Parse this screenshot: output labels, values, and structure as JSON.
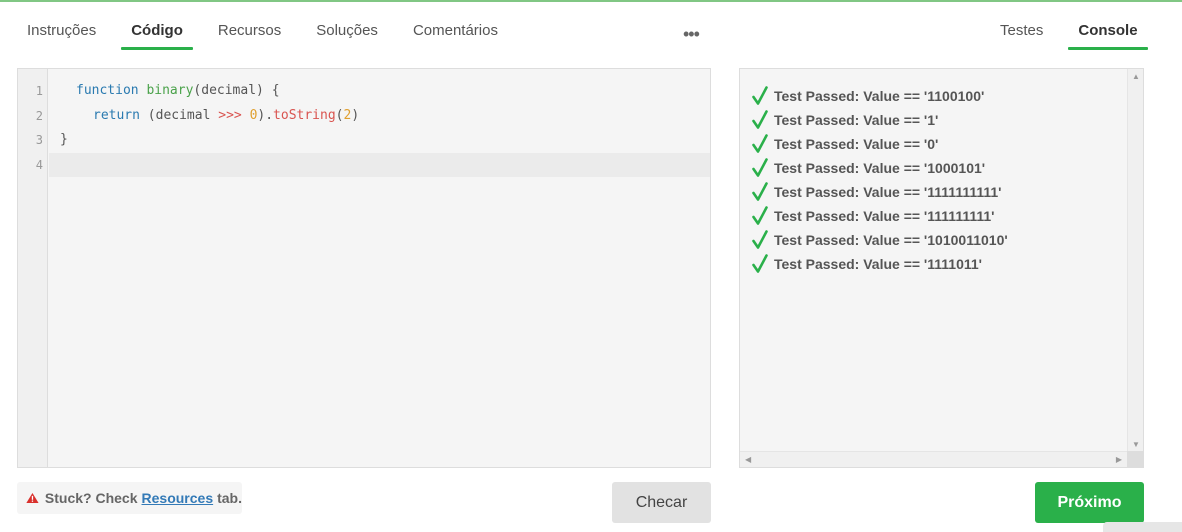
{
  "tabs_left": [
    "Instruções",
    "Código",
    "Recursos",
    "Soluções",
    "Comentários"
  ],
  "more_label": "•••",
  "tabs_right": [
    "Testes",
    "Console"
  ],
  "editor": {
    "line_numbers": [
      "1",
      "2",
      "3",
      "4"
    ],
    "code": {
      "l1_kw": "function",
      "l1_fn": "binary",
      "l1_rest": "(decimal) {",
      "l2_kw": "return",
      "l2_a": "(decimal ",
      "l2_op": ">>>",
      "l2_sp": " ",
      "l2_n1": "0",
      "l2_b": ").",
      "l2_fn": "toString",
      "l2_c": "(",
      "l2_n2": "2",
      "l2_d": ")",
      "l3": "}"
    }
  },
  "console": {
    "results": [
      "Test Passed: Value == '1100100'",
      "Test Passed: Value == '1'",
      "Test Passed: Value == '0'",
      "Test Passed: Value == '1000101'",
      "Test Passed: Value == '1111111111'",
      "Test Passed: Value == '111111111'",
      "Test Passed: Value == '1010011010'",
      "Test Passed: Value == '1111011'"
    ]
  },
  "footer": {
    "stuck_prefix": "Stuck? Check",
    "stuck_link": "Resources",
    "stuck_suffix": "tab.",
    "check_label": "Checar",
    "next_label": "Próximo"
  },
  "colors": {
    "accent": "#2ab04a",
    "link": "#337ab7",
    "warning": "#d9302c"
  }
}
